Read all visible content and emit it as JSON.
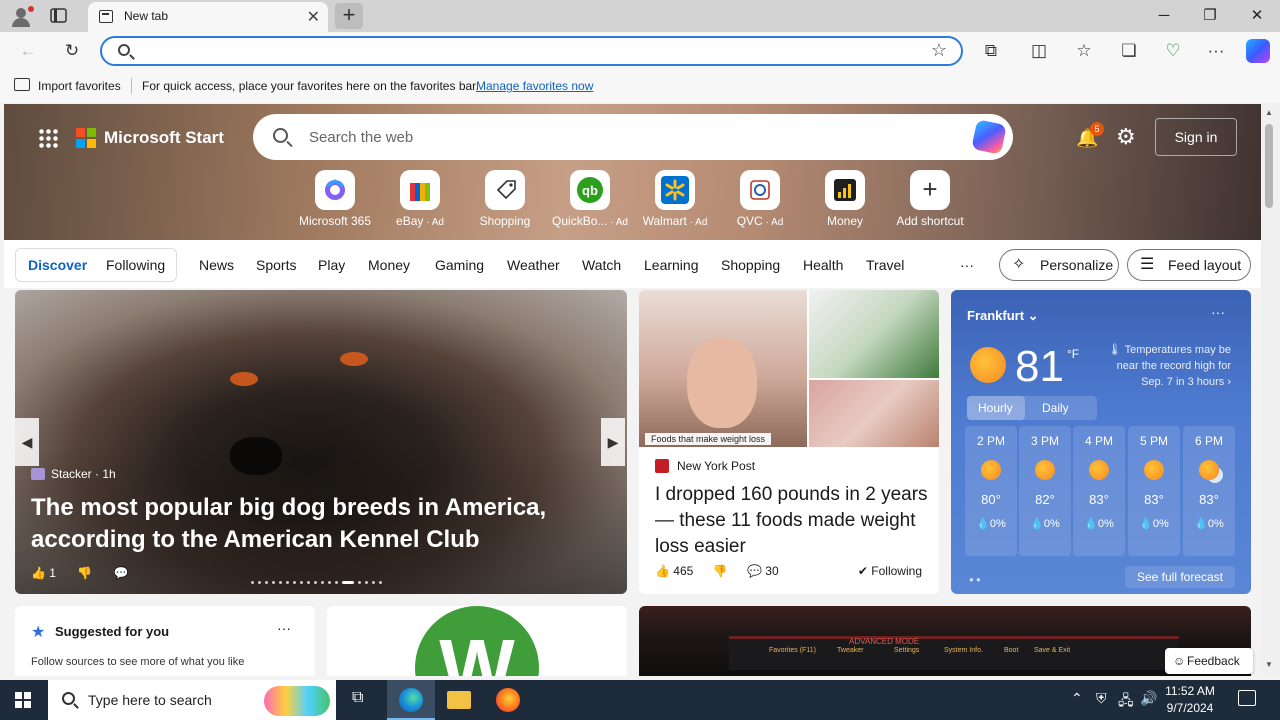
{
  "browser": {
    "tab_title": "New tab",
    "tab_close": "✕",
    "new_tab": "+",
    "window_controls": {
      "minimize": "─",
      "maximize": "❐",
      "close": "✕"
    },
    "address_placeholder": "",
    "toolbar_icons": [
      "back-icon",
      "refresh-icon",
      "extensions-icon",
      "split-screen-icon",
      "favorites-icon",
      "collections-icon",
      "performance-icon",
      "more-icon",
      "copilot-icon"
    ]
  },
  "favorites_bar": {
    "import_label": "Import favorites",
    "message": "For quick access, place your favorites here on the favorites bar.",
    "manage_link": "Manage favorites now"
  },
  "header": {
    "brand": "Microsoft Start",
    "search_placeholder": "Search the web",
    "notification_count": "5",
    "sign_in": "Sign in"
  },
  "shortcuts": [
    {
      "label": "Microsoft 365",
      "ad": ""
    },
    {
      "label": "eBay",
      "ad": " · Ad"
    },
    {
      "label": "Shopping",
      "ad": ""
    },
    {
      "label": "QuickBo...",
      "ad": " · Ad"
    },
    {
      "label": "Walmart",
      "ad": " · Ad"
    },
    {
      "label": "QVC",
      "ad": " · Ad"
    },
    {
      "label": "Money",
      "ad": ""
    },
    {
      "label": "Add shortcut",
      "ad": ""
    }
  ],
  "nav": {
    "discover": "Discover",
    "following": "Following",
    "items": [
      "News",
      "Sports",
      "Play",
      "Money",
      "Gaming",
      "Weather",
      "Watch",
      "Learning",
      "Shopping",
      "Health",
      "Travel"
    ],
    "more": "···",
    "personalize": "Personalize",
    "feed_layout": "Feed layout"
  },
  "hero_story": {
    "source": "Stacker · 1h",
    "headline": "The most popular big dog breeds in America, according to the American Kennel Club",
    "likes": "1",
    "prev": "◀",
    "next": "▶"
  },
  "nyp_story": {
    "image_tag": "Foods that make weight loss",
    "source": "New York Post",
    "headline": "I dropped 160 pounds in 2 years — these 11 foods made weight loss easier",
    "likes": "465",
    "comments": "30",
    "following": "Following"
  },
  "weather": {
    "city": "Frankfurt",
    "more": "···",
    "temp": "81",
    "unit": "°F",
    "alert": "Temperatures may be near the record high for Sep. 7 in 3 hours",
    "tab_hourly": "Hourly",
    "tab_daily": "Daily",
    "hours": [
      {
        "time": "2 PM",
        "temp": "80°",
        "precip": "💧0%"
      },
      {
        "time": "3 PM",
        "temp": "82°",
        "precip": "💧0%"
      },
      {
        "time": "4 PM",
        "temp": "83°",
        "precip": "💧0%"
      },
      {
        "time": "5 PM",
        "temp": "83°",
        "precip": "💧0%"
      },
      {
        "time": "6 PM",
        "temp": "83°",
        "precip": "💧0%"
      }
    ],
    "see_forecast": "See full forecast"
  },
  "suggested": {
    "title": "Suggested for you",
    "more": "···",
    "description": "Follow sources to see more of what you like"
  },
  "wcard": {
    "letter": "W"
  },
  "game_card": {
    "labels": [
      "ADVANCED MODE",
      "Favorites (F11)",
      "Tweaker",
      "Settings",
      "System Info.",
      "Boot",
      "Save & Exit"
    ]
  },
  "feedback": "Feedback",
  "taskbar": {
    "search_placeholder": "Type here to search",
    "time": "11:52 AM",
    "date": "9/7/2024"
  }
}
